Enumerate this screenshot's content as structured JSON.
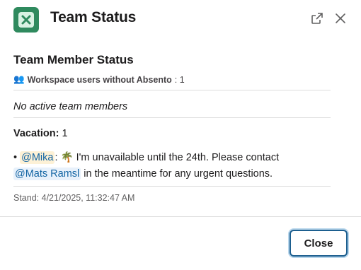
{
  "header": {
    "title": "Team Status",
    "icons": {
      "app": "absento-app-icon",
      "popout": "external-link-icon",
      "close": "close-icon"
    }
  },
  "section": {
    "title": "Team Member Status",
    "users_icon": "👥",
    "users_label": "Workspace users without Absento",
    "users_count": ": 1",
    "no_active": "No active team members",
    "vacation_label": "Vacation:",
    "vacation_count": " 1"
  },
  "entry": {
    "bullet": "•",
    "mention_user": "@Mika",
    "colon": ":",
    "emoji": "🌴",
    "text_1": "I'm unavailable until the 24th. Please contact",
    "mention_contact": "@Mats Ramsl",
    "text_2": "in the meantime for any urgent questions."
  },
  "stand": "Stand: 4/21/2025, 11:32:47 AM",
  "footer": {
    "close_label": "Close"
  },
  "colors": {
    "app_icon": "#2f8a5e",
    "mention": "#1264a3",
    "button_border": "#1d5f8f"
  }
}
